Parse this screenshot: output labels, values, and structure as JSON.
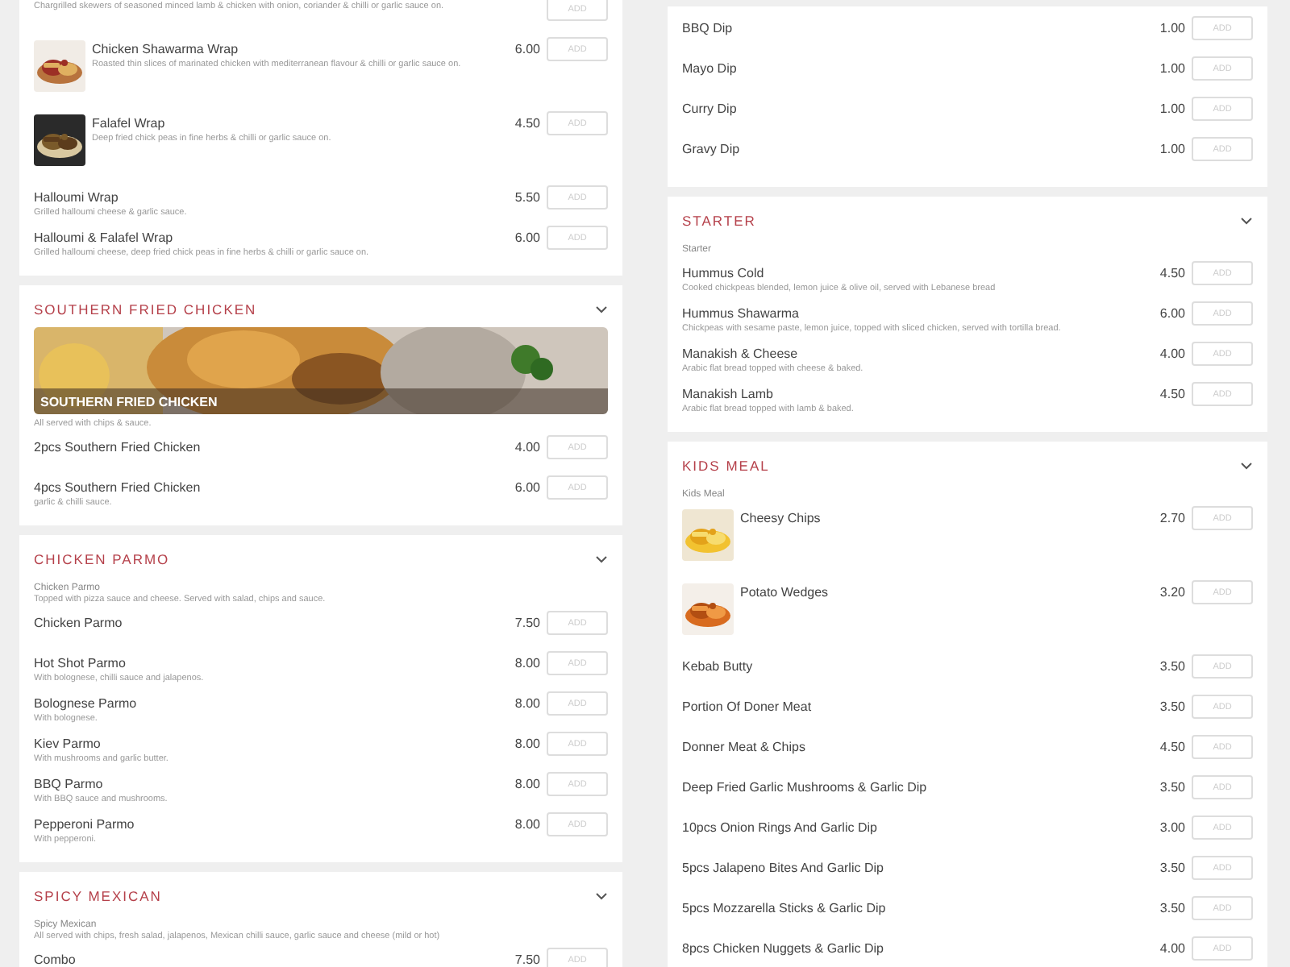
{
  "columns": [
    {
      "sections": [
        {
          "items": [
            {
              "kind": "plain",
              "description": "Chargrilled skewers of seasoned minced lamb & chicken with onion, coriander & chilli or garlic sauce on.",
              "button": "ADD"
            },
            {
              "kind": "picture",
              "name": "Chicken Shawarma Wrap",
              "description": "Roasted thin slices of marinated chicken with mediterranean flavour & chilli or garlic sauce on.",
              "price": "6.00",
              "button": "ADD"
            },
            {
              "kind": "picture",
              "name": "Falafel Wrap",
              "description": "Deep fried chick peas in fine herbs & chilli or garlic sauce on.",
              "price": "4.50",
              "button": "ADD"
            },
            {
              "kind": "plain",
              "name": "Halloumi Wrap",
              "description": "Grilled halloumi cheese & garlic sauce.",
              "price": "5.50",
              "button": "ADD"
            },
            {
              "kind": "plain",
              "name": "Halloumi & Falafel Wrap",
              "description": "Grilled halloumi cheese, deep fried chick peas in fine herbs & chilli or garlic sauce on.",
              "price": "6.00",
              "button": "ADD"
            }
          ]
        },
        {
          "title": "SOUTHERN FRIED CHICKEN",
          "banner": "SOUTHERN FRIED CHICKEN",
          "note": "All served with chips & sauce.",
          "items": [
            {
              "kind": "plain",
              "name": "2pcs Southern Fried Chicken",
              "price": "4.00",
              "button": "ADD"
            },
            {
              "kind": "plain",
              "name": "4pcs Southern Fried Chicken",
              "description": "garlic & chilli sauce.",
              "price": "6.00",
              "button": "ADD"
            }
          ]
        },
        {
          "title": "CHICKEN PARMO",
          "subtitle": "Chicken Parmo",
          "note": "Topped with pizza sauce and cheese. Served with salad, chips and sauce.",
          "items": [
            {
              "kind": "plain",
              "name": "Chicken Parmo",
              "price": "7.50",
              "button": "ADD"
            },
            {
              "kind": "plain",
              "name": "Hot Shot Parmo",
              "description": "With bolognese, chilli sauce and jalapenos.",
              "price": "8.00",
              "button": "ADD"
            },
            {
              "kind": "plain",
              "name": "Bolognese Parmo",
              "description": "With bolognese.",
              "price": "8.00",
              "button": "ADD"
            },
            {
              "kind": "plain",
              "name": "Kiev Parmo",
              "description": "With mushrooms and garlic butter.",
              "price": "8.00",
              "button": "ADD"
            },
            {
              "kind": "plain",
              "name": "BBQ Parmo",
              "description": "With BBQ sauce and mushrooms.",
              "price": "8.00",
              "button": "ADD"
            },
            {
              "kind": "plain",
              "name": "Pepperoni Parmo",
              "description": "With pepperoni.",
              "price": "8.00",
              "button": "ADD"
            }
          ]
        },
        {
          "title": "SPICY MEXICAN",
          "subtitle": "Spicy Mexican",
          "note": "All served with chips, fresh salad, jalapenos, Mexican chilli sauce, garlic sauce and cheese (mild or hot)",
          "items": [
            {
              "kind": "plain",
              "name": "Combo",
              "price": "7.50",
              "button": "ADD"
            }
          ]
        }
      ]
    },
    {
      "sections": [
        {
          "items": [
            {
              "kind": "plain",
              "name": "BBQ Dip",
              "price": "1.00",
              "button": "ADD"
            },
            {
              "kind": "plain",
              "name": "Mayo Dip",
              "price": "1.00",
              "button": "ADD"
            },
            {
              "kind": "plain",
              "name": "Curry Dip",
              "price": "1.00",
              "button": "ADD"
            },
            {
              "kind": "plain",
              "name": "Gravy Dip",
              "price": "1.00",
              "button": "ADD"
            }
          ]
        },
        {
          "title": "STARTER",
          "subtitle": "Starter",
          "items": [
            {
              "kind": "plain",
              "name": "Hummus Cold",
              "description": "Cooked chickpeas blended, lemon juice & olive oil, served with Lebanese bread",
              "price": "4.50",
              "button": "ADD"
            },
            {
              "kind": "plain",
              "name": "Hummus Shawarma",
              "description": "Chickpeas with sesame paste, lemon juice, topped with sliced chicken, served with tortilla bread.",
              "price": "6.00",
              "button": "ADD"
            },
            {
              "kind": "plain",
              "name": "Manakish & Cheese",
              "description": "Arabic flat bread topped with cheese & baked.",
              "price": "4.00",
              "button": "ADD"
            },
            {
              "kind": "plain",
              "name": "Manakish Lamb",
              "description": "Arabic flat bread topped with lamb & baked.",
              "price": "4.50",
              "button": "ADD"
            }
          ]
        },
        {
          "title": "KIDS MEAL",
          "subtitle": "Kids Meal",
          "items": [
            {
              "kind": "picture",
              "name": "Cheesy Chips",
              "price": "2.70",
              "button": "ADD"
            },
            {
              "kind": "picture",
              "name": "Potato Wedges",
              "price": "3.20",
              "button": "ADD"
            },
            {
              "kind": "plain",
              "name": "Kebab Butty",
              "price": "3.50",
              "button": "ADD"
            },
            {
              "kind": "plain",
              "name": "Portion Of Doner Meat",
              "price": "3.50",
              "button": "ADD"
            },
            {
              "kind": "plain",
              "name": "Donner Meat & Chips",
              "price": "4.50",
              "button": "ADD"
            },
            {
              "kind": "plain",
              "name": "Deep Fried Garlic Mushrooms & Garlic Dip",
              "price": "3.50",
              "button": "ADD"
            },
            {
              "kind": "plain",
              "name": "10pcs Onion Rings And Garlic Dip",
              "price": "3.00",
              "button": "ADD"
            },
            {
              "kind": "plain",
              "name": "5pcs Jalapeno Bites And Garlic Dip",
              "price": "3.50",
              "button": "ADD"
            },
            {
              "kind": "plain",
              "name": "5pcs Mozzarella Sticks & Garlic Dip",
              "price": "3.50",
              "button": "ADD"
            },
            {
              "kind": "plain",
              "name": "8pcs Chicken Nuggets & Garlic Dip",
              "price": "4.00",
              "button": "ADD"
            }
          ]
        }
      ]
    }
  ]
}
